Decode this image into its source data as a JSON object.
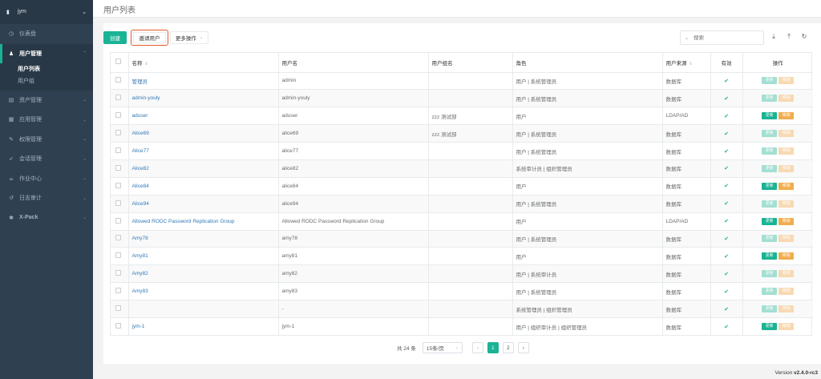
{
  "sidebar": {
    "org_name": "jym",
    "items": [
      {
        "icon": "dashboard-icon",
        "glyph": "◷",
        "label": "仪表盘",
        "has_children": false
      },
      {
        "icon": "users-icon",
        "glyph": "♟",
        "label": "用户管理",
        "has_children": true,
        "expanded": true,
        "children": [
          {
            "label": "用户列表",
            "current": true
          },
          {
            "label": "用户组",
            "current": false
          }
        ]
      },
      {
        "icon": "inbox-icon",
        "glyph": "▤",
        "label": "资产管理",
        "has_children": true
      },
      {
        "icon": "grid-icon",
        "glyph": "▦",
        "label": "应用管理",
        "has_children": true
      },
      {
        "icon": "edit-icon",
        "glyph": "✎",
        "label": "权限管理",
        "has_children": true
      },
      {
        "icon": "rocket-icon",
        "glyph": "➶",
        "label": "会话管理",
        "has_children": true
      },
      {
        "icon": "coffee-icon",
        "glyph": "☕",
        "label": "作业中心",
        "has_children": true
      },
      {
        "icon": "history-icon",
        "glyph": "↺",
        "label": "日志审计",
        "has_children": true
      },
      {
        "icon": "puzzle-icon",
        "glyph": "✱",
        "label": "X-Pack",
        "has_children": true
      }
    ]
  },
  "page": {
    "title": "用户列表"
  },
  "toolbar": {
    "create_label": "创建",
    "invite_label": "邀请用户",
    "more_label": "更多操作",
    "search_placeholder": "搜索",
    "icons": [
      "download-icon",
      "upload-icon",
      "refresh-icon"
    ]
  },
  "table": {
    "columns": [
      "",
      "名称",
      "用户名",
      "用户组名",
      "角色",
      "用户来源",
      "有效",
      "操作"
    ],
    "sortable": [
      false,
      true,
      false,
      false,
      false,
      true,
      false,
      false
    ],
    "update_label": "更新",
    "remove_label": "移除",
    "rows": [
      {
        "name": "管理员",
        "username": "admin",
        "group": "",
        "role": "用户 | 系统管理员",
        "source": "数据库",
        "valid": true,
        "update_enabled": false,
        "remove_enabled": false
      },
      {
        "name": "admin-youly",
        "username": "admin-youly",
        "group": "",
        "role": "用户 | 系统管理员",
        "source": "数据库",
        "valid": true,
        "update_enabled": false,
        "remove_enabled": false
      },
      {
        "name": "aduser",
        "username": "aduser",
        "group": "zzz 测试部",
        "role": "用户",
        "source": "LDAP/AD",
        "valid": true,
        "update_enabled": true,
        "remove_enabled": true
      },
      {
        "name": "Alice69",
        "username": "alice69",
        "group": "zzz 测试部",
        "role": "用户 | 系统管理员",
        "source": "数据库",
        "valid": true,
        "update_enabled": false,
        "remove_enabled": false
      },
      {
        "name": "Alice77",
        "username": "alice77",
        "group": "",
        "role": "用户 | 系统管理员",
        "source": "数据库",
        "valid": true,
        "update_enabled": false,
        "remove_enabled": false
      },
      {
        "name": "Alice82",
        "username": "alice82",
        "group": "",
        "role": "系统审计员 | 组织管理员",
        "source": "数据库",
        "valid": true,
        "update_enabled": false,
        "remove_enabled": false
      },
      {
        "name": "Alice84",
        "username": "alice84",
        "group": "",
        "role": "用户",
        "source": "数据库",
        "valid": true,
        "update_enabled": true,
        "remove_enabled": true
      },
      {
        "name": "Alice94",
        "username": "alice94",
        "group": "",
        "role": "用户 | 系统管理员",
        "source": "数据库",
        "valid": true,
        "update_enabled": false,
        "remove_enabled": false
      },
      {
        "name": "Allowed RODC Password Replication Group",
        "username": "Allowed RODC Password Replication Group",
        "group": "",
        "role": "用户",
        "source": "LDAP/AD",
        "valid": true,
        "update_enabled": true,
        "remove_enabled": true
      },
      {
        "name": "Amy78",
        "username": "amy78",
        "group": "",
        "role": "用户 | 系统管理员",
        "source": "数据库",
        "valid": true,
        "update_enabled": false,
        "remove_enabled": false
      },
      {
        "name": "Amy81",
        "username": "amy81",
        "group": "",
        "role": "用户",
        "source": "数据库",
        "valid": true,
        "update_enabled": true,
        "remove_enabled": true
      },
      {
        "name": "Amy82",
        "username": "amy82",
        "group": "",
        "role": "用户 | 系统审计员",
        "source": "数据库",
        "valid": true,
        "update_enabled": false,
        "remove_enabled": false
      },
      {
        "name": "Amy83",
        "username": "amy83",
        "group": "",
        "role": "用户 | 系统管理员",
        "source": "数据库",
        "valid": true,
        "update_enabled": false,
        "remove_enabled": false
      },
      {
        "name": "",
        "username": "-",
        "group": "",
        "role": "系统管理员 | 组织管理员",
        "source": "数据库",
        "valid": true,
        "update_enabled": false,
        "remove_enabled": false
      },
      {
        "name": "jym-1",
        "username": "jym-1",
        "group": "",
        "role": "用户 | 组织审计员 | 组织管理员",
        "source": "数据库",
        "valid": true,
        "update_enabled": true,
        "remove_enabled": false
      }
    ]
  },
  "pagination": {
    "total_text": "共 24 条",
    "page_size": "15条/页",
    "pages": [
      "1",
      "2"
    ],
    "current": "1"
  },
  "footer": {
    "version_label": "Version",
    "version": "v2.4.0-rc3"
  },
  "colors": {
    "sidebar_bg": "#2f4050",
    "accent": "#1ab394",
    "warning": "#f0ad4e",
    "highlight_border": "#e05a2b",
    "link": "#337ab7"
  }
}
